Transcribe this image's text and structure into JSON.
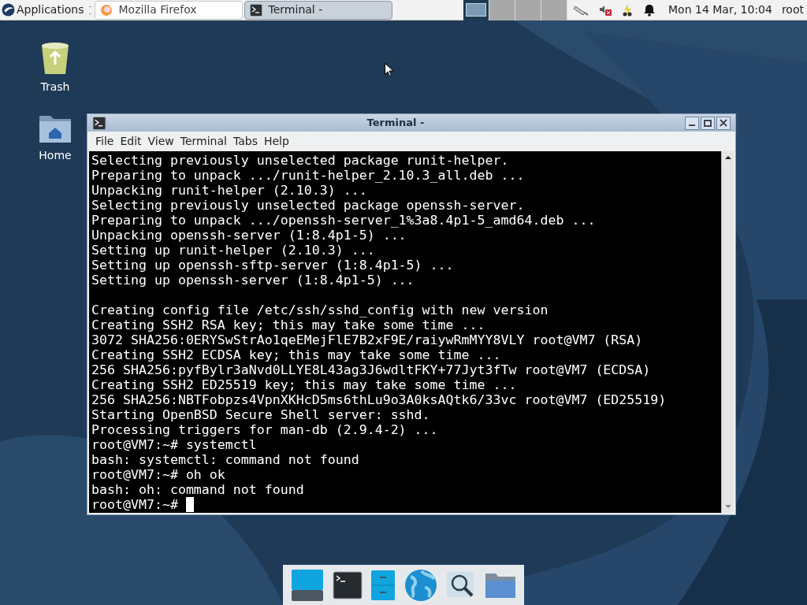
{
  "top_panel": {
    "applications": "Applications",
    "tasks": [
      {
        "label": "Mozilla Firefox",
        "kind": "browser",
        "selected": false
      },
      {
        "label": "Terminal -",
        "kind": "terminal",
        "selected": true
      }
    ],
    "workspaces": [
      {
        "selected": true
      },
      {
        "selected": false
      },
      {
        "selected": false
      },
      {
        "selected": false
      }
    ],
    "clock": "Mon 14 Mar, 10:04",
    "user": "root"
  },
  "desktop_icons": [
    {
      "label": "Trash",
      "kind": "trash"
    },
    {
      "label": "Home",
      "kind": "home"
    }
  ],
  "window": {
    "title": "Terminal -",
    "menu": [
      "File",
      "Edit",
      "View",
      "Terminal",
      "Tabs",
      "Help"
    ],
    "lines": [
      {
        "kind": "text",
        "text": "Selecting previously unselected package runit-helper."
      },
      {
        "kind": "text",
        "text": "Preparing to unpack .../runit-helper_2.10.3_all.deb ..."
      },
      {
        "kind": "text",
        "text": "Unpacking runit-helper (2.10.3) ..."
      },
      {
        "kind": "text",
        "text": "Selecting previously unselected package openssh-server."
      },
      {
        "kind": "text",
        "text": "Preparing to unpack .../openssh-server_1%3a8.4p1-5_amd64.deb ..."
      },
      {
        "kind": "text",
        "text": "Unpacking openssh-server (1:8.4p1-5) ..."
      },
      {
        "kind": "text",
        "text": "Setting up runit-helper (2.10.3) ..."
      },
      {
        "kind": "text",
        "text": "Setting up openssh-sftp-server (1:8.4p1-5) ..."
      },
      {
        "kind": "text",
        "text": "Setting up openssh-server (1:8.4p1-5) ..."
      },
      {
        "kind": "blank"
      },
      {
        "kind": "text",
        "text": "Creating config file /etc/ssh/sshd_config with new version"
      },
      {
        "kind": "text",
        "text": "Creating SSH2 RSA key; this may take some time ..."
      },
      {
        "kind": "text",
        "text": "3072 SHA256:0ERYSwStrAo1qeEMejFlE7B2xF9E/raiywRmMYY8VLY root@VM7 (RSA)"
      },
      {
        "kind": "text",
        "text": "Creating SSH2 ECDSA key; this may take some time ..."
      },
      {
        "kind": "text",
        "text": "256 SHA256:pyfBylr3aNvd0LLYE8L43ag3J6wdltFKY+77Jyt3fTw root@VM7 (ECDSA)"
      },
      {
        "kind": "text",
        "text": "Creating SSH2 ED25519 key; this may take some time ..."
      },
      {
        "kind": "text",
        "text": "256 SHA256:NBTFobpzs4VpnXKHcD5ms6thLu9o3A0ksAQtk6/33vc root@VM7 (ED25519)"
      },
      {
        "kind": "text",
        "text": "Starting OpenBSD Secure Shell server: sshd."
      },
      {
        "kind": "text",
        "text": "Processing triggers for man-db (2.9.4-2) ..."
      },
      {
        "kind": "text",
        "text": "root@VM7:~# systemctl"
      },
      {
        "kind": "text",
        "text": "bash: systemctl: command not found"
      },
      {
        "kind": "text",
        "text": "root@VM7:~# oh ok"
      },
      {
        "kind": "text",
        "text": "bash: oh: command not found"
      },
      {
        "kind": "prompt",
        "text": "root@VM7:~#"
      }
    ]
  },
  "dock": [
    {
      "kind": "desktop"
    },
    {
      "kind": "terminal"
    },
    {
      "kind": "files"
    },
    {
      "kind": "browser"
    },
    {
      "kind": "search"
    },
    {
      "kind": "folder"
    }
  ]
}
